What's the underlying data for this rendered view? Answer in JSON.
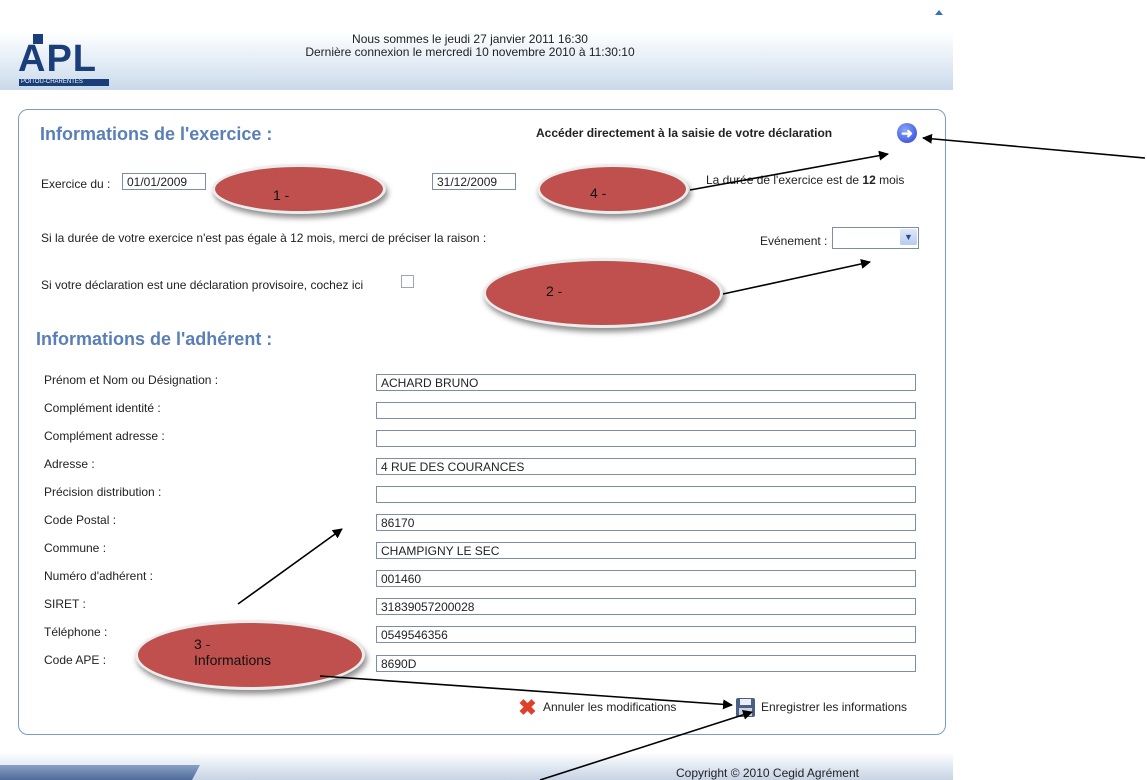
{
  "header": {
    "logo_text": "APL",
    "logo_subtext": "POITOU-CHARENTES",
    "date_line": "Nous sommes le jeudi 27 janvier 2011 16:30",
    "last_login_line": "Dernière connexion le mercredi 10 novembre 2010 à 11:30:10"
  },
  "exercice": {
    "title": "Informations de l'exercice :",
    "direct_access_label": "Accéder directement à la saisie de votre déclaration",
    "from_label": "Exercice du :",
    "from_value": "01/01/2009",
    "to_value": "31/12/2009",
    "duration_text_before": "La durée de l'exercice est de ",
    "duration_value": "12",
    "duration_text_after": " mois",
    "reason_text": "Si la durée de votre exercice n'est pas égale à 12 mois, merci de préciser la raison :",
    "event_label": "Evénement :",
    "event_value": "",
    "provisional_text": "Si votre déclaration est une déclaration provisoire, cochez ici"
  },
  "adherent": {
    "title": "Informations de l'adhérent :",
    "fields": [
      {
        "label": "Prénom et Nom ou Désignation :",
        "value": "ACHARD  BRUNO"
      },
      {
        "label": "Complément identité :",
        "value": ""
      },
      {
        "label": "Complément adresse :",
        "value": ""
      },
      {
        "label": "Adresse :",
        "value": "4 RUE DES COURANCES"
      },
      {
        "label": "Précision distribution :",
        "value": ""
      },
      {
        "label": "Code Postal :",
        "value": "86170"
      },
      {
        "label": "Commune :",
        "value": "CHAMPIGNY LE SEC"
      },
      {
        "label": "Numéro d'adhérent :",
        "value": "001460"
      },
      {
        "label": "SIRET :",
        "value": "31839057200028"
      },
      {
        "label": "Téléphone :",
        "value": "0549546356"
      },
      {
        "label": "Code APE :",
        "value": "8690D"
      }
    ]
  },
  "actions": {
    "cancel_label": "Annuler les modifications",
    "save_label": "Enregistrer les informations"
  },
  "annotations": {
    "oval1": "1 -",
    "oval2": "2 -",
    "oval3_line1": "3 -",
    "oval3_line2": "Informations",
    "oval4": "4 -"
  },
  "footer": {
    "copyright": "Copyright © 2010 Cegid Agrément"
  },
  "colors": {
    "title_blue": "#5a7fb8",
    "annotation_red": "#c0504d",
    "panel_border": "#7a9cc8"
  }
}
